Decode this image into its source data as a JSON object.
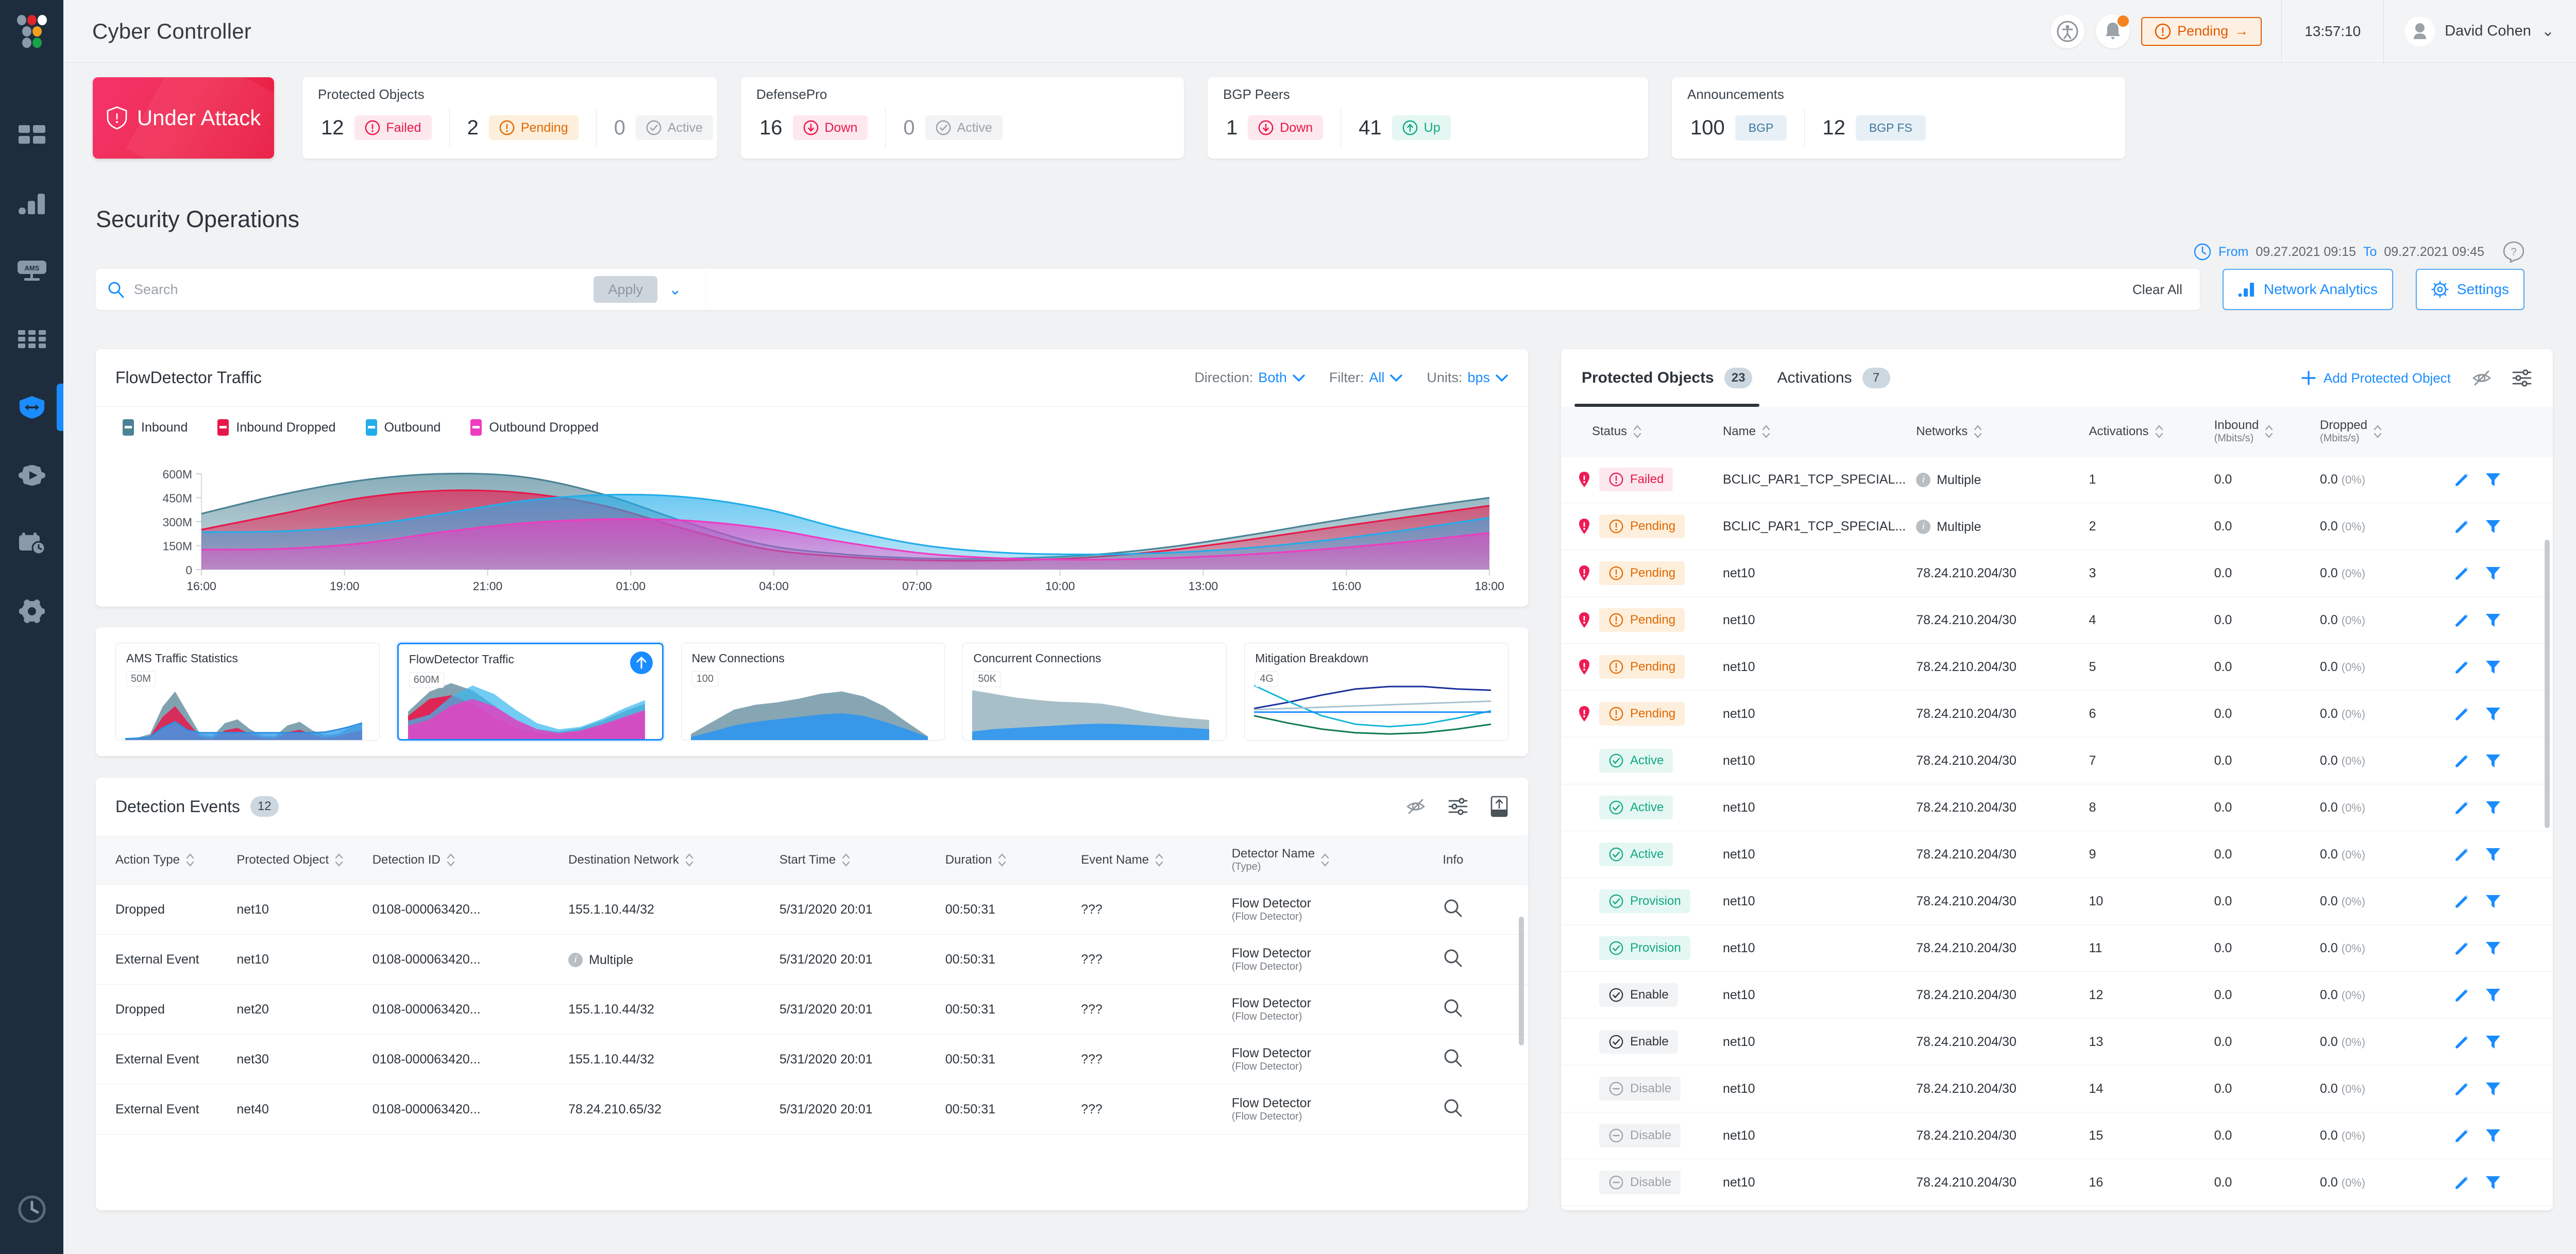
{
  "app": {
    "title": "Cyber Controller"
  },
  "topbar": {
    "accessibility_icon": "accessibility-icon",
    "bell_icon": "bell-icon",
    "pending_button": "Pending",
    "pending_arrow": "→",
    "clock": "13:57:10",
    "user_name": "David Cohen",
    "caret": "⌄"
  },
  "rail": {
    "items": [
      {
        "name": "dashboard-icon"
      },
      {
        "name": "analytics-icon"
      },
      {
        "name": "ams-monitor-icon"
      },
      {
        "name": "apps-grid-icon"
      },
      {
        "name": "protection-shield-icon"
      },
      {
        "name": "workflow-gear-icon"
      },
      {
        "name": "scheduler-icon"
      },
      {
        "name": "settings-gear-icon"
      }
    ],
    "bottom_icon": "history-clock-icon"
  },
  "under_attack": {
    "label": "Under Attack",
    "icon": "shield-alert-icon"
  },
  "kpi_cards": [
    {
      "title": "Protected Objects",
      "stats": [
        {
          "value": "12",
          "label": "Failed",
          "style": "failed",
          "icon": "alert-circle-icon"
        },
        {
          "value": "2",
          "label": "Pending",
          "style": "pending",
          "icon": "alert-circle-icon"
        },
        {
          "value": "0",
          "label": "Active",
          "style": "active",
          "icon": "check-circle-icon",
          "muted": true
        }
      ]
    },
    {
      "title": "DefensePro",
      "stats": [
        {
          "value": "16",
          "label": "Down",
          "style": "down",
          "icon": "arrow-down-circle-icon"
        },
        {
          "value": "0",
          "label": "Active",
          "style": "active",
          "icon": "check-circle-icon",
          "muted": true
        }
      ]
    },
    {
      "title": "BGP Peers",
      "stats": [
        {
          "value": "1",
          "label": "Down",
          "style": "down",
          "icon": "arrow-down-circle-icon"
        },
        {
          "value": "41",
          "label": "Up",
          "style": "up",
          "icon": "arrow-up-circle-icon"
        }
      ]
    },
    {
      "title": "Announcements",
      "stats": [
        {
          "value": "100",
          "label": "BGP",
          "style": "bgp",
          "icon": ""
        },
        {
          "value": "12",
          "label": "BGP FS",
          "style": "bgp",
          "icon": ""
        }
      ]
    }
  ],
  "section": {
    "title": "Security Operations"
  },
  "time_range": {
    "clock_icon": "clock-icon",
    "from_label": "From",
    "from_value": "09.27.2021 09:15",
    "to_label": "To",
    "to_value": "09.27.2021 09:45",
    "help_icon": "help-icon"
  },
  "search": {
    "placeholder": "Search",
    "value": "",
    "apply_label": "Apply",
    "caret": "⌄",
    "clear_all": "Clear All",
    "network_analytics": "Network Analytics",
    "settings": "Settings"
  },
  "chart_panel": {
    "title": "FlowDetector Traffic",
    "controls": [
      {
        "label": "Direction:",
        "value": "Both"
      },
      {
        "label": "Filter:",
        "value": "All"
      },
      {
        "label": "Units:",
        "value": "bps"
      }
    ]
  },
  "chart_data": {
    "type": "area",
    "title": "FlowDetector Traffic",
    "xlabel": "",
    "ylabel": "bps",
    "ylim": [
      0,
      600000000
    ],
    "ytick_labels": [
      "0",
      "150M",
      "300M",
      "450M",
      "600M"
    ],
    "ytick_values": [
      0,
      150000000,
      300000000,
      450000000,
      600000000
    ],
    "xtick_labels": [
      "16:00",
      "19:00",
      "21:00",
      "01:00",
      "04:00",
      "07:00",
      "10:00",
      "13:00",
      "16:00",
      "18:00"
    ],
    "grid": true,
    "legend_position": "top-left",
    "series": [
      {
        "name": "Inbound",
        "color": "#4b8395",
        "values": [
          350000000,
          470000000,
          560000000,
          600000000,
          580000000,
          470000000,
          300000000,
          155000000,
          95000000,
          70000000,
          70000000,
          90000000,
          140000000,
          215000000,
          300000000,
          380000000,
          450000000
        ]
      },
      {
        "name": "Inbound Dropped",
        "color": "#e8174a",
        "values": [
          250000000,
          350000000,
          450000000,
          495000000,
          480000000,
          400000000,
          255000000,
          130000000,
          80000000,
          58000000,
          58000000,
          76000000,
          120000000,
          186000000,
          260000000,
          330000000,
          400000000
        ]
      },
      {
        "name": "Outbound",
        "color": "#22adea",
        "values": [
          235000000,
          240000000,
          275000000,
          350000000,
          430000000,
          468000000,
          455000000,
          380000000,
          250000000,
          150000000,
          105000000,
          95000000,
          105000000,
          135000000,
          185000000,
          250000000,
          325000000
        ]
      },
      {
        "name": "Outbound Dropped",
        "color": "#ef3bc0",
        "values": [
          125000000,
          130000000,
          165000000,
          235000000,
          290000000,
          315000000,
          308000000,
          258000000,
          170000000,
          100000000,
          70000000,
          62000000,
          72000000,
          95000000,
          130000000,
          175000000,
          230000000
        ]
      }
    ]
  },
  "thumbnails": [
    {
      "title": "AMS Traffic Statistics",
      "tag": "50M",
      "selected": false,
      "kind": "spikes"
    },
    {
      "title": "FlowDetector Traffic",
      "tag": "600M",
      "selected": true,
      "kind": "flow",
      "up_icon": "arrow-up-icon"
    },
    {
      "title": "New Connections",
      "tag": "100",
      "selected": false,
      "kind": "hump"
    },
    {
      "title": "Concurrent Connections",
      "tag": "50K",
      "selected": false,
      "kind": "slope"
    },
    {
      "title": "Mitigation Breakdown",
      "tag": "4G",
      "selected": false,
      "kind": "lines"
    }
  ],
  "detection_events": {
    "title": "Detection Events",
    "count": "12",
    "icons": [
      "hide-icon",
      "column-settings-icon",
      "export-icon"
    ],
    "columns": [
      {
        "label": "Action Type",
        "sortable": true
      },
      {
        "label": "Protected Object",
        "sortable": true
      },
      {
        "label": "Detection ID",
        "sortable": true
      },
      {
        "label": "Destination Network",
        "sortable": true
      },
      {
        "label": "Start Time",
        "sortable": true
      },
      {
        "label": "Duration",
        "sortable": true
      },
      {
        "label": "Event Name",
        "sortable": true
      },
      {
        "label": "Detector Name",
        "sub": "(Type)",
        "sortable": true
      },
      {
        "label": "Info",
        "sortable": false
      }
    ],
    "rows": [
      {
        "action": "Dropped",
        "po": "net10",
        "detection_id": "0108-000063420...",
        "dest": "155.1.10.44/32",
        "dest_multiple": false,
        "start": "5/31/2020 20:01",
        "duration": "00:50:31",
        "event": "???",
        "detector": "Flow Detector",
        "detector_type": "(Flow Detector)"
      },
      {
        "action": "External Event",
        "po": "net10",
        "detection_id": "0108-000063420...",
        "dest": "Multiple",
        "dest_multiple": true,
        "start": "5/31/2020 20:01",
        "duration": "00:50:31",
        "event": "???",
        "detector": "Flow Detector",
        "detector_type": "(Flow Detector)"
      },
      {
        "action": "Dropped",
        "po": "net20",
        "detection_id": "0108-000063420...",
        "dest": "155.1.10.44/32",
        "dest_multiple": false,
        "start": "5/31/2020 20:01",
        "duration": "00:50:31",
        "event": "???",
        "detector": "Flow Detector",
        "detector_type": "(Flow Detector)"
      },
      {
        "action": "External Event",
        "po": "net30",
        "detection_id": "0108-000063420...",
        "dest": "155.1.10.44/32",
        "dest_multiple": false,
        "start": "5/31/2020 20:01",
        "duration": "00:50:31",
        "event": "???",
        "detector": "Flow Detector",
        "detector_type": "(Flow Detector)"
      },
      {
        "action": "External Event",
        "po": "net40",
        "detection_id": "0108-000063420...",
        "dest": "78.24.210.65/32",
        "dest_multiple": false,
        "start": "5/31/2020 20:01",
        "duration": "00:50:31",
        "event": "???",
        "detector": "Flow Detector",
        "detector_type": "(Flow Detector)"
      }
    ]
  },
  "protected_objects": {
    "tabs": [
      {
        "label": "Protected Objects",
        "count": "23",
        "selected": true
      },
      {
        "label": "Activations",
        "count": "7",
        "selected": false
      }
    ],
    "add_label": "Add Protected Object",
    "icons": [
      "hide-icon",
      "column-settings-icon"
    ],
    "columns": [
      {
        "label": "Status",
        "sortable": true
      },
      {
        "label": "Name",
        "sortable": true
      },
      {
        "label": "Networks",
        "sortable": true
      },
      {
        "label": "Activations",
        "sortable": true
      },
      {
        "label": "Inbound",
        "sub": "(Mbits/s)",
        "sortable": true
      },
      {
        "label": "Dropped",
        "sub": "(Mbits/s)",
        "sortable": true
      }
    ],
    "rows": [
      {
        "sev": true,
        "status": "Failed",
        "style": "failed",
        "name": "BCLIC_PAR1_TCP_SPECIAL...",
        "network": "Multiple",
        "multiple": true,
        "activations": "1",
        "inbound": "0.0",
        "dropped": "0.0",
        "dropped_pct": "(0%)"
      },
      {
        "sev": true,
        "status": "Pending",
        "style": "pending",
        "name": "BCLIC_PAR1_TCP_SPECIAL...",
        "network": "Multiple",
        "multiple": true,
        "activations": "2",
        "inbound": "0.0",
        "dropped": "0.0",
        "dropped_pct": "(0%)"
      },
      {
        "sev": true,
        "status": "Pending",
        "style": "pending",
        "name": "net10",
        "network": "78.24.210.204/30",
        "multiple": false,
        "activations": "3",
        "inbound": "0.0",
        "dropped": "0.0",
        "dropped_pct": "(0%)"
      },
      {
        "sev": true,
        "status": "Pending",
        "style": "pending",
        "name": "net10",
        "network": "78.24.210.204/30",
        "multiple": false,
        "activations": "4",
        "inbound": "0.0",
        "dropped": "0.0",
        "dropped_pct": "(0%)"
      },
      {
        "sev": true,
        "status": "Pending",
        "style": "pending",
        "name": "net10",
        "network": "78.24.210.204/30",
        "multiple": false,
        "activations": "5",
        "inbound": "0.0",
        "dropped": "0.0",
        "dropped_pct": "(0%)"
      },
      {
        "sev": true,
        "status": "Pending",
        "style": "pending",
        "name": "net10",
        "network": "78.24.210.204/30",
        "multiple": false,
        "activations": "6",
        "inbound": "0.0",
        "dropped": "0.0",
        "dropped_pct": "(0%)"
      },
      {
        "sev": false,
        "status": "Active",
        "style": "active",
        "name": "net10",
        "network": "78.24.210.204/30",
        "multiple": false,
        "activations": "7",
        "inbound": "0.0",
        "dropped": "0.0",
        "dropped_pct": "(0%)"
      },
      {
        "sev": false,
        "status": "Active",
        "style": "active",
        "name": "net10",
        "network": "78.24.210.204/30",
        "multiple": false,
        "activations": "8",
        "inbound": "0.0",
        "dropped": "0.0",
        "dropped_pct": "(0%)"
      },
      {
        "sev": false,
        "status": "Active",
        "style": "active",
        "name": "net10",
        "network": "78.24.210.204/30",
        "multiple": false,
        "activations": "9",
        "inbound": "0.0",
        "dropped": "0.0",
        "dropped_pct": "(0%)"
      },
      {
        "sev": false,
        "status": "Provision",
        "style": "provision",
        "name": "net10",
        "network": "78.24.210.204/30",
        "multiple": false,
        "activations": "10",
        "inbound": "0.0",
        "dropped": "0.0",
        "dropped_pct": "(0%)"
      },
      {
        "sev": false,
        "status": "Provision",
        "style": "provision",
        "name": "net10",
        "network": "78.24.210.204/30",
        "multiple": false,
        "activations": "11",
        "inbound": "0.0",
        "dropped": "0.0",
        "dropped_pct": "(0%)"
      },
      {
        "sev": false,
        "status": "Enable",
        "style": "enable",
        "name": "net10",
        "network": "78.24.210.204/30",
        "multiple": false,
        "activations": "12",
        "inbound": "0.0",
        "dropped": "0.0",
        "dropped_pct": "(0%)"
      },
      {
        "sev": false,
        "status": "Enable",
        "style": "enable",
        "name": "net10",
        "network": "78.24.210.204/30",
        "multiple": false,
        "activations": "13",
        "inbound": "0.0",
        "dropped": "0.0",
        "dropped_pct": "(0%)"
      },
      {
        "sev": false,
        "status": "Disable",
        "style": "disable",
        "name": "net10",
        "network": "78.24.210.204/30",
        "multiple": false,
        "activations": "14",
        "inbound": "0.0",
        "dropped": "0.0",
        "dropped_pct": "(0%)"
      },
      {
        "sev": false,
        "status": "Disable",
        "style": "disable",
        "name": "net10",
        "network": "78.24.210.204/30",
        "multiple": false,
        "activations": "15",
        "inbound": "0.0",
        "dropped": "0.0",
        "dropped_pct": "(0%)"
      },
      {
        "sev": false,
        "status": "Disable",
        "style": "disable",
        "name": "net10",
        "network": "78.24.210.204/30",
        "multiple": false,
        "activations": "16",
        "inbound": "0.0",
        "dropped": "0.0",
        "dropped_pct": "(0%)"
      }
    ]
  },
  "colors": {
    "accent": "#1a8cff",
    "danger": "#e8174a",
    "warning": "#e06800",
    "success": "#12a883",
    "rail": "#1e2d3d"
  }
}
